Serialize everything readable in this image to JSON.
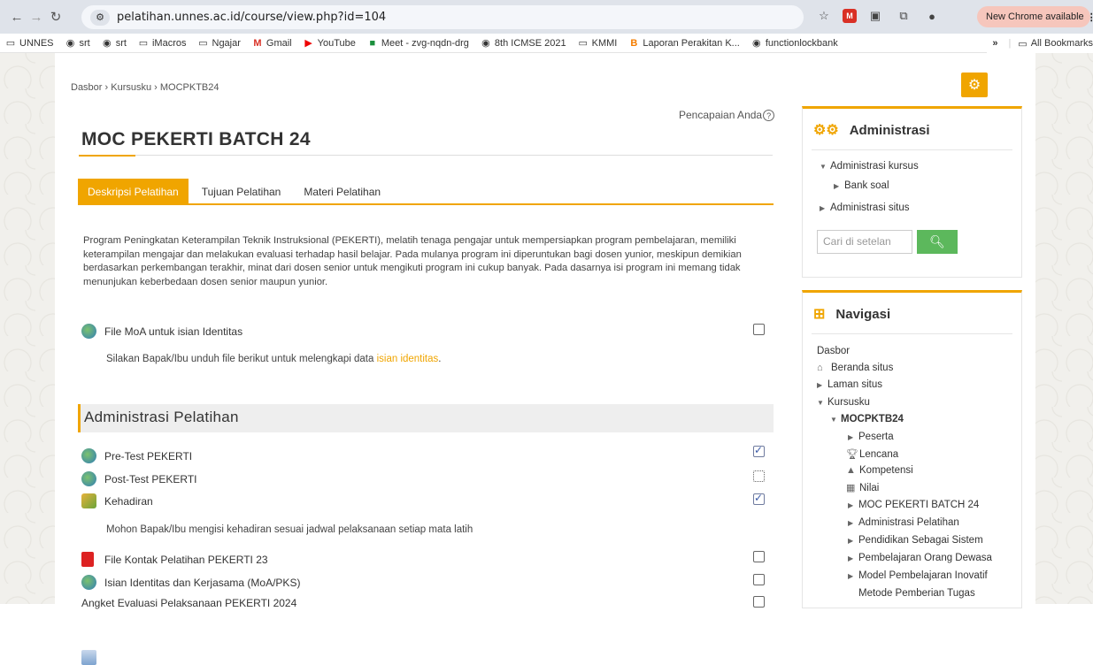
{
  "browser": {
    "url": "pelatihan.unnes.ac.id/course/view.php?id=104",
    "new_chrome": "New Chrome available",
    "bookmarks": [
      "UNNES",
      "srt",
      "srt",
      "iMacros",
      "Ngajar",
      "Gmail",
      "YouTube",
      "Meet - zvg-nqdn-drg",
      "8th ICMSE 2021",
      "KMMI",
      "Laporan Perakitan K...",
      "functionlockbank"
    ],
    "all_bookmarks": "All Bookmarks",
    "more": "»"
  },
  "breadcrumb": "Dasbor › Kursusku › MOCPKTB24",
  "pencapaian": "Pencapaian Anda",
  "course_title": "MOC PEKERTI BATCH 24",
  "tabs": [
    "Deskripsi Pelatihan",
    "Tujuan Pelatihan",
    "Materi Pelatihan"
  ],
  "description": "Program Peningkatan Keterampilan Teknik Instruksional (PEKERTI), melatih tenaga pengajar untuk mempersiapkan program pembelajaran, memiliki keterampilan mengajar dan melakukan evaluasi terhadap hasil belajar. Pada mulanya program ini diperuntukan bagi dosen yunior, meskipun demikian berdasarkan perkembangan terakhir, minat dari dosen senior untuk mengikuti program ini cukup banyak. Pada dasarnya isi program ini memang tidak menunjukan keberbedaan dosen senior maupun yunior.",
  "moa": {
    "label": "File MoA untuk isian Identitas",
    "note": "Silakan Bapak/Ibu unduh file berikut untuk melengkapi data ",
    "link": "isian identitas",
    "end": "."
  },
  "section_title": "Administrasi Pelatihan",
  "activities": [
    {
      "label": "Pre-Test PEKERTI",
      "icon": "quiz-icon",
      "status": "done"
    },
    {
      "label": "Post-Test PEKERTI",
      "icon": "quiz-icon",
      "status": "pending"
    },
    {
      "label": "Kehadiran",
      "icon": "attendance-icon",
      "status": "done"
    },
    {
      "label": "File Kontak Pelatihan PEKERTI 23",
      "icon": "pdf-icon",
      "status": "open"
    },
    {
      "label": "Isian Identitas dan Kerjasama (MoA/PKS)",
      "icon": "quiz-icon",
      "status": "open"
    },
    {
      "label": "Angket Evaluasi Pelaksanaan PEKERTI 2024",
      "icon": "page-icon",
      "status": "open"
    }
  ],
  "kehadiran_note": "Mohon Bapak/Ibu mengisi kehadiran sesuai jadwal pelaksanaan setiap mata latih",
  "admin_block": {
    "title": "Administrasi",
    "items": [
      "Administrasi kursus",
      "Bank soal",
      "Administrasi situs"
    ],
    "search_placeholder": "Cari di setelan"
  },
  "nav_block": {
    "title": "Navigasi",
    "items": [
      "Dasbor",
      "Beranda situs",
      "Laman situs",
      "Kursusku",
      "MOCPKTB24",
      "Peserta",
      "Lencana",
      "Kompetensi",
      "Nilai",
      "MOC PEKERTI BATCH 24",
      "Administrasi Pelatihan",
      "Pendidikan Sebagai Sistem",
      "Pembelajaran Orang Dewasa",
      "Model Pembelajaran Inovatif",
      "Metode Pemberian Tugas"
    ]
  },
  "colors": {
    "accent": "#f0a500",
    "search_button": "#5cb85c"
  }
}
